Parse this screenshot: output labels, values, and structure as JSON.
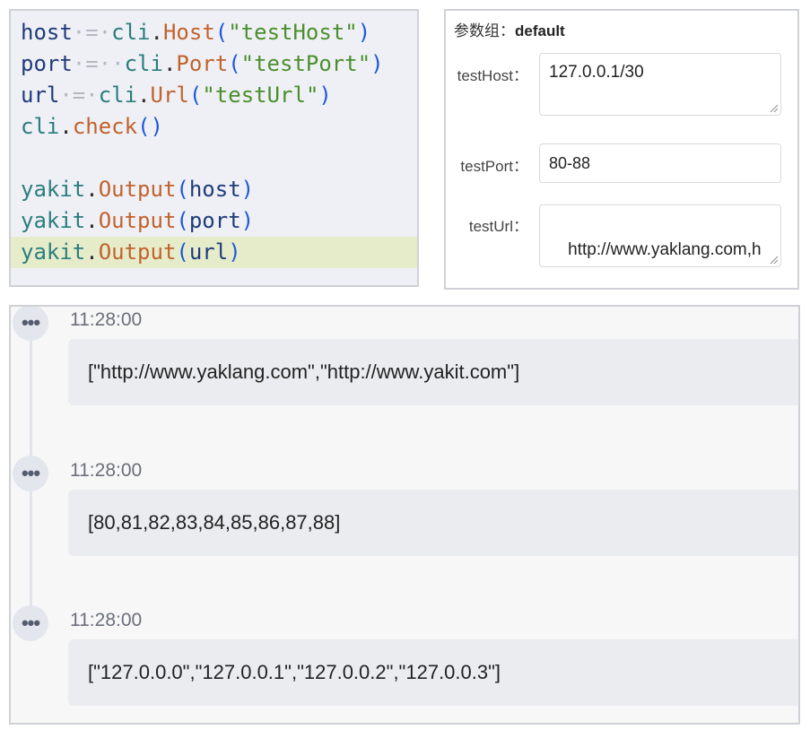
{
  "code": {
    "lines": [
      {
        "var": "host",
        "spaces": "·=·",
        "mod": "cli",
        "fn": "Host",
        "arg": "\"testHost\""
      },
      {
        "var": "port",
        "spaces": "·=··",
        "mod": "cli",
        "fn": "Port",
        "arg": "\"testPort\""
      },
      {
        "var": "url",
        "spaces": "·=·",
        "mod": "cli",
        "fn": "Url",
        "arg": "\"testUrl\""
      },
      {
        "mod": "cli",
        "fn": "check",
        "arg": ""
      },
      {
        "mod": "yakit",
        "fn": "Output",
        "arg": "host"
      },
      {
        "mod": "yakit",
        "fn": "Output",
        "arg": "port"
      },
      {
        "mod": "yakit",
        "fn": "Output",
        "arg": "url"
      }
    ]
  },
  "params": {
    "group_label": "参数组：",
    "group_name": "default",
    "fields": [
      {
        "label": "testHost：",
        "value": "127.0.0.1/30"
      },
      {
        "label": "testPort：",
        "value": "80-88"
      },
      {
        "label": "testUrl：",
        "value": "http://www.yaklang.com,h\nttp://www.yakit.com"
      }
    ]
  },
  "log": {
    "entries": [
      {
        "time": "11:28:00",
        "output": "[\"http://www.yaklang.com\",\"http://www.yakit.com\"]"
      },
      {
        "time": "11:28:00",
        "output": "[80,81,82,83,84,85,86,87,88]"
      },
      {
        "time": "11:28:00",
        "output": "[\"127.0.0.0\",\"127.0.0.1\",\"127.0.0.2\",\"127.0.0.3\"]"
      }
    ],
    "dots_icon": "more-dots-icon"
  }
}
